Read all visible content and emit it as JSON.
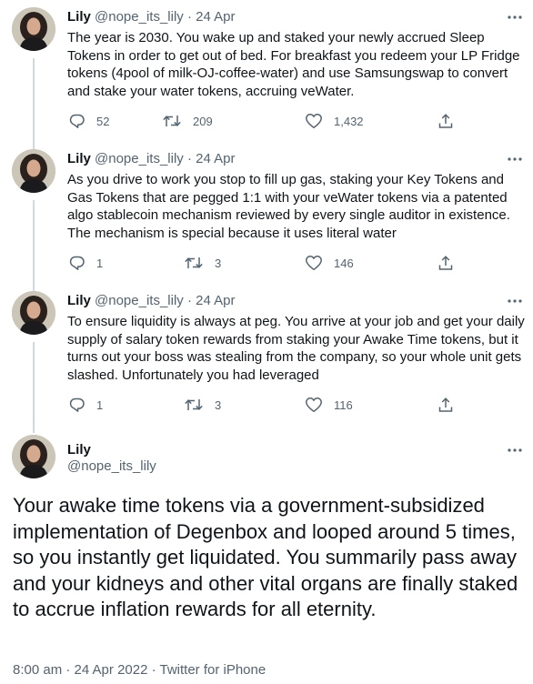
{
  "thread": [
    {
      "name": "Lily",
      "handle": "@nope_its_lily",
      "dot": "·",
      "date": "24 Apr",
      "text": "The year is 2030. You wake up and staked your newly accrued Sleep Tokens in order to get out of bed. For breakfast you redeem your LP Fridge tokens (4pool of milk-OJ-coffee-water) and use Samsungswap to convert and stake your water tokens, accruing veWater.",
      "replies": "52",
      "retweets": "209",
      "likes": "1,432"
    },
    {
      "name": "Lily",
      "handle": "@nope_its_lily",
      "dot": "·",
      "date": "24 Apr",
      "text": "As you drive to work you stop to fill up gas, staking your Key Tokens and Gas Tokens that are pegged 1:1 with your veWater tokens via a patented algo stablecoin mechanism reviewed by every single auditor in existence. The mechanism is special because it uses literal water",
      "replies": "1",
      "retweets": "3",
      "likes": "146"
    },
    {
      "name": "Lily",
      "handle": "@nope_its_lily",
      "dot": "·",
      "date": "24 Apr",
      "text": "To ensure liquidity is always at peg. You arrive at your job and get your daily supply of salary token rewards from staking your Awake Time tokens, but it turns out your boss was stealing from the company, so your whole unit gets slashed. Unfortunately you had leveraged",
      "replies": "1",
      "retweets": "3",
      "likes": "116"
    }
  ],
  "main": {
    "name": "Lily",
    "handle": "@nope_its_lily",
    "text": "Your awake time tokens via a government-subsidized implementation of Degenbox and looped around 5 times, so you instantly get liquidated. You summarily pass away and your kidneys and other vital organs are finally staked to accrue inflation rewards for all eternity.",
    "meta": "8:00 am · 24 Apr 2022 · Twitter for iPhone"
  },
  "icons": {
    "reply": "reply-icon",
    "retweet": "retweet-icon",
    "like": "heart-icon",
    "share": "share-icon",
    "more": "more-icon"
  },
  "colors": {
    "text": "#0f1419",
    "secondary": "#536471",
    "thread_line": "#cfd9de"
  }
}
